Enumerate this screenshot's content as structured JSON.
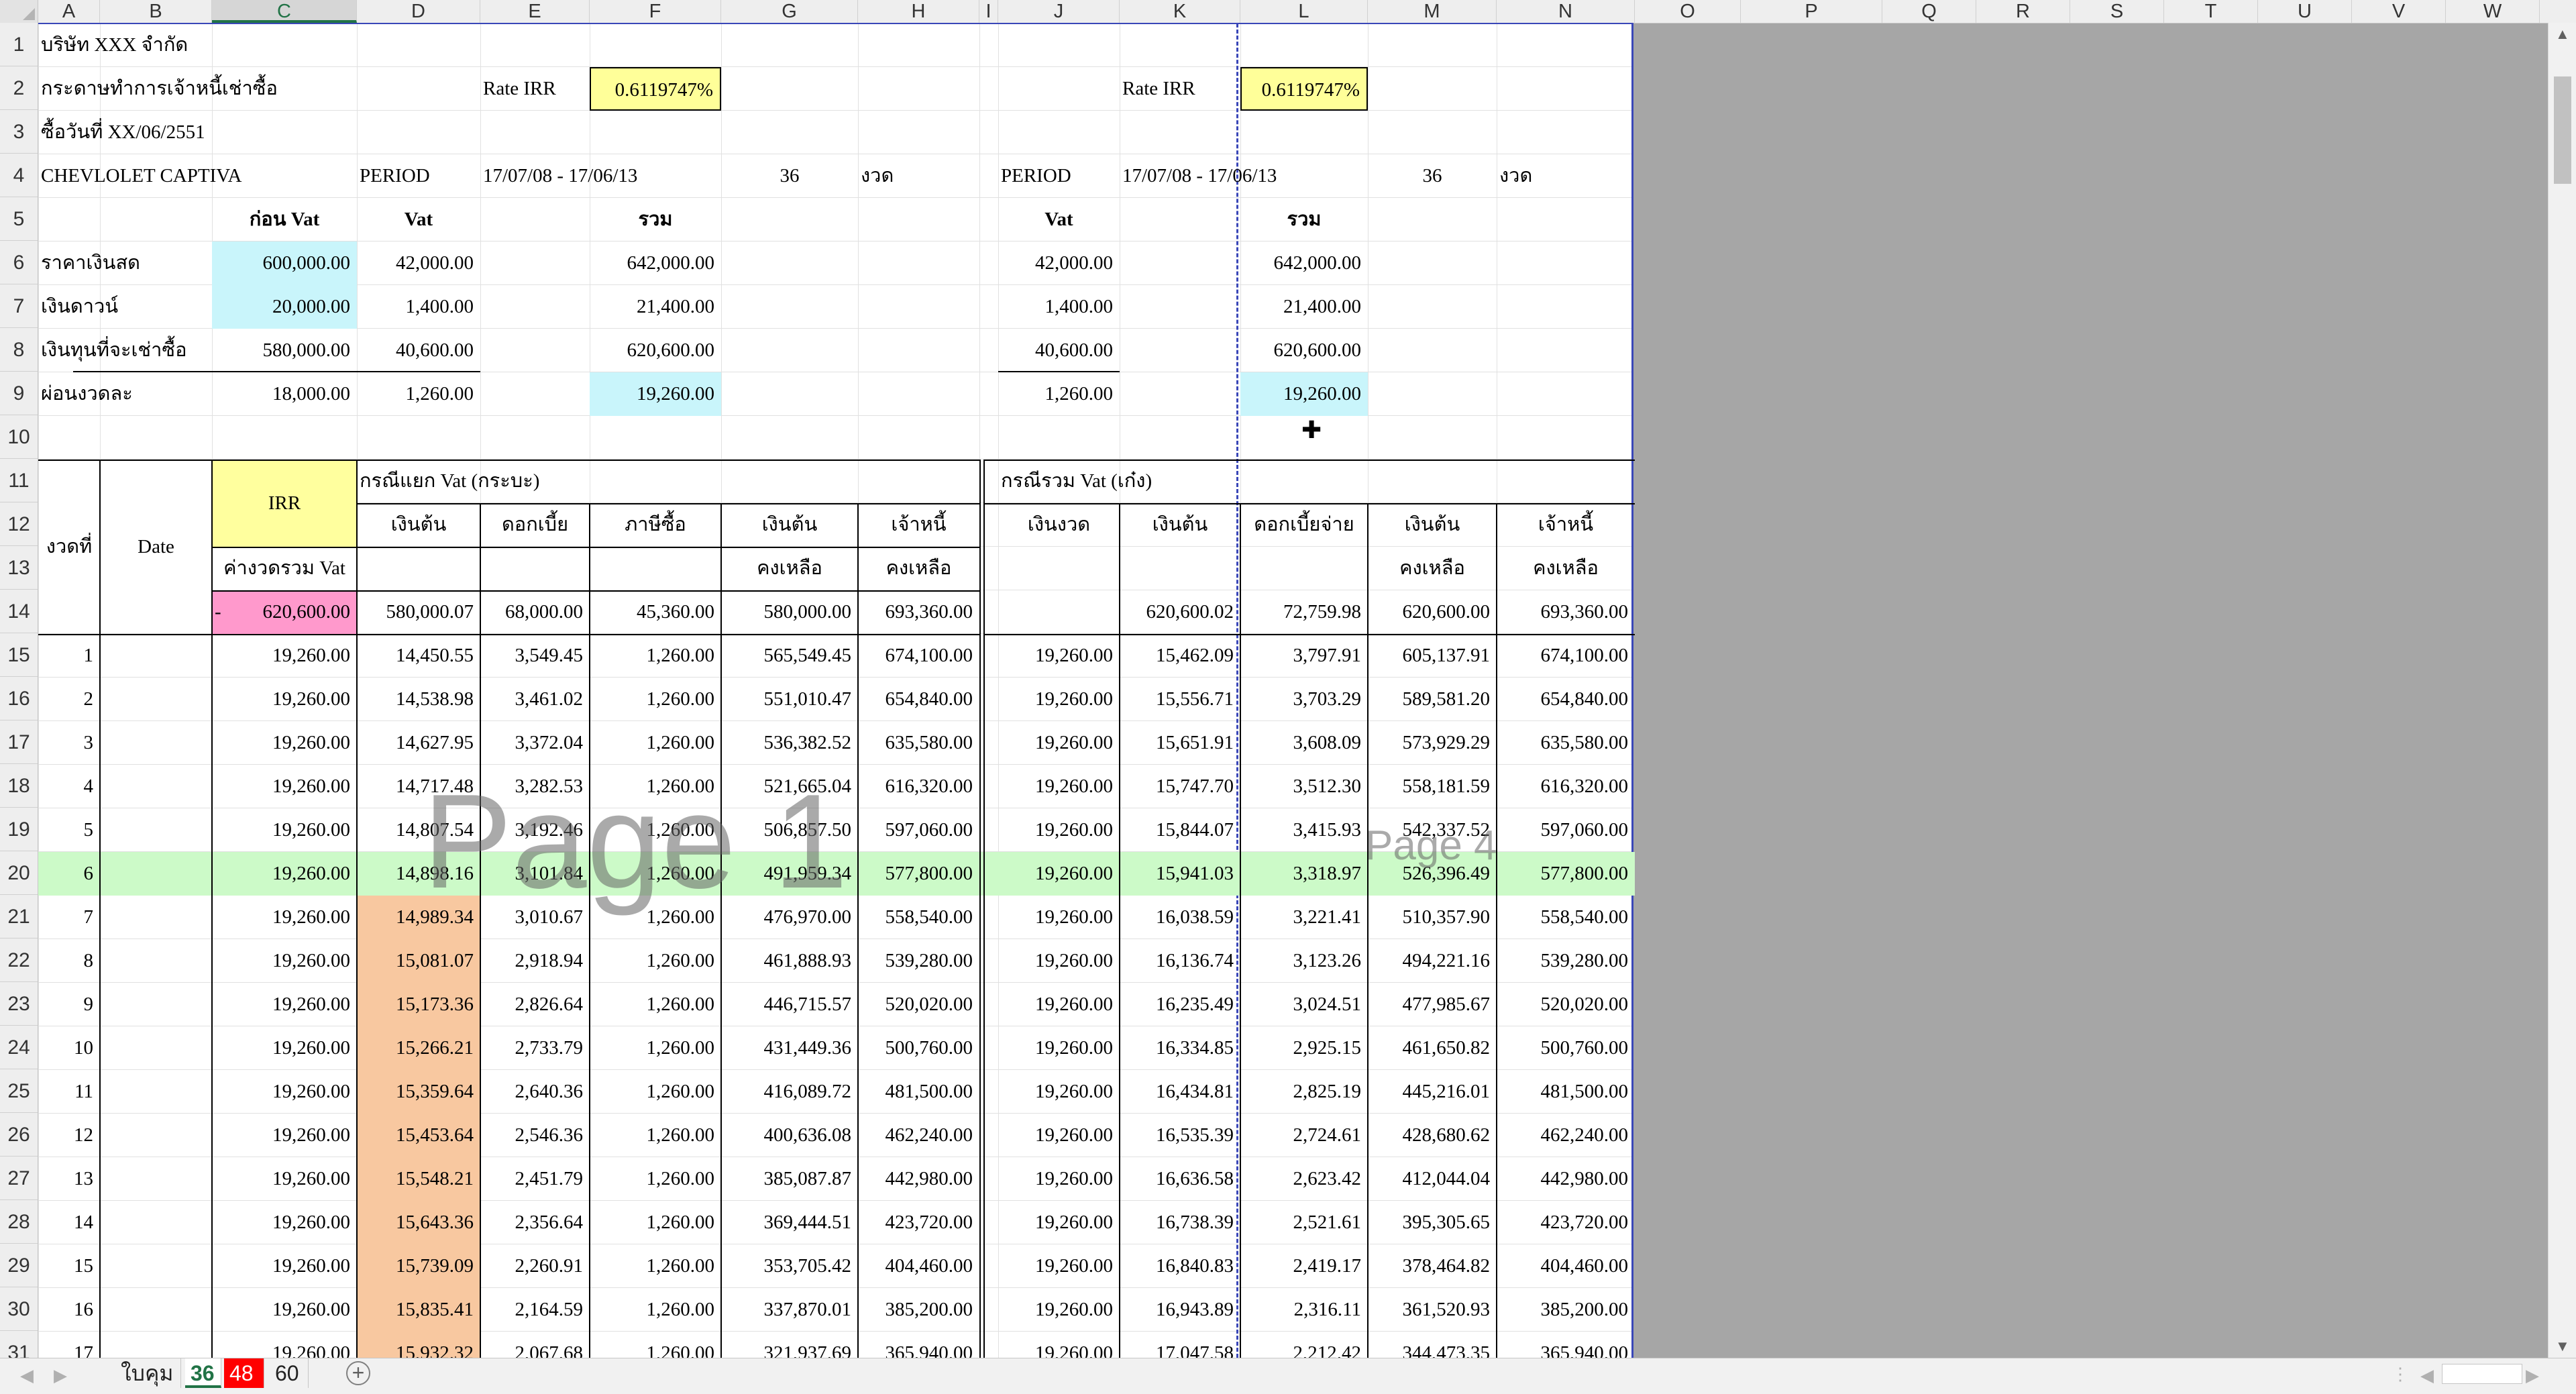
{
  "app": {
    "name": "Spreadsheet"
  },
  "columns": [
    "A",
    "B",
    "C",
    "D",
    "E",
    "F",
    "G",
    "H",
    "I",
    "J",
    "K",
    "L",
    "M",
    "N",
    "O",
    "P",
    "Q",
    "R",
    "S",
    "T",
    "U",
    "V",
    "W"
  ],
  "active_column": "C",
  "rows": [
    "1",
    "2",
    "3",
    "4",
    "5",
    "6",
    "7",
    "8",
    "9",
    "10",
    "11",
    "12",
    "13",
    "14",
    "15",
    "16",
    "17",
    "18",
    "19",
    "20",
    "21",
    "22",
    "23",
    "24",
    "25",
    "26",
    "27",
    "28",
    "29",
    "30",
    "31"
  ],
  "header": {
    "company": "บริษัท XXX จำกัด",
    "desc": "กระดาษทำการเจ้าหนี้เช่าซื้อ",
    "purchase_date": "ซื้อวันที่ XX/06/2551",
    "car": "CHEVLOLET CAPTIVA",
    "rate_label": "Rate IRR",
    "rate_value": "0.6119747%",
    "period_label": "PERIOD",
    "period_value": "17/07/08 - 17/06/13",
    "period_count": "36",
    "period_unit": "งวด",
    "col_before_vat": "ก่อน Vat",
    "col_vat": "Vat",
    "col_total": "รวม"
  },
  "summary": [
    {
      "label": "ราคาเงินสด",
      "before": "600,000.00",
      "vat": "42,000.00",
      "total": "642,000.00",
      "r_vat": "42,000.00",
      "r_total": "642,000.00"
    },
    {
      "label": "เงินดาวน์",
      "before": "20,000.00",
      "vat": "1,400.00",
      "total": "21,400.00",
      "r_vat": "1,400.00",
      "r_total": "21,400.00"
    },
    {
      "label": "เงินทุนที่จะเช่าซื้อ",
      "before": "580,000.00",
      "vat": "40,600.00",
      "total": "620,600.00",
      "r_vat": "40,600.00",
      "r_total": "620,600.00"
    },
    {
      "label": "ผ่อนงวดละ",
      "before": "18,000.00",
      "vat": "1,260.00",
      "total": "19,260.00",
      "r_vat": "1,260.00",
      "r_total": "19,260.00"
    }
  ],
  "table_header": {
    "no": "งวดที่",
    "date": "Date",
    "irr": "IRR",
    "irr_sub": "ค่างวดรวม Vat",
    "left_title": "กรณีแยก Vat (กระบะ)",
    "left_cols": [
      "เงินต้น",
      "ดอกเบี้ย",
      "ภาษีซื้อ",
      "เงินต้น",
      "เจ้าหนี้"
    ],
    "left_sub": [
      "",
      "",
      "",
      "คงเหลือ",
      "คงเหลือ"
    ],
    "right_title": "กรณีรวม Vat (เก๋ง)",
    "right_cols": [
      "เงินงวด",
      "เงินต้น",
      "ดอกเบี้ยจ่าย",
      "เงินต้น",
      "เจ้าหนี้"
    ],
    "right_sub": [
      "",
      "",
      "",
      "คงเหลือ",
      "คงเหลือ"
    ]
  },
  "row14": {
    "dash": "-",
    "c": "620,600.00",
    "d": "580,000.07",
    "e": "68,000.00",
    "f": "45,360.00",
    "g": "580,000.00",
    "h": "693,360.00",
    "k": "620,600.02",
    "l": "72,759.98",
    "m": "620,600.00",
    "n": "693,360.00"
  },
  "schedule": [
    {
      "n": "1",
      "c": "19,260.00",
      "d": "14,450.55",
      "e": "3,549.45",
      "f": "1,260.00",
      "g": "565,549.45",
      "h": "674,100.00",
      "j": "19,260.00",
      "k": "15,462.09",
      "l": "3,797.91",
      "m": "605,137.91",
      "nn": "674,100.00"
    },
    {
      "n": "2",
      "c": "19,260.00",
      "d": "14,538.98",
      "e": "3,461.02",
      "f": "1,260.00",
      "g": "551,010.47",
      "h": "654,840.00",
      "j": "19,260.00",
      "k": "15,556.71",
      "l": "3,703.29",
      "m": "589,581.20",
      "nn": "654,840.00"
    },
    {
      "n": "3",
      "c": "19,260.00",
      "d": "14,627.95",
      "e": "3,372.04",
      "f": "1,260.00",
      "g": "536,382.52",
      "h": "635,580.00",
      "j": "19,260.00",
      "k": "15,651.91",
      "l": "3,608.09",
      "m": "573,929.29",
      "nn": "635,580.00"
    },
    {
      "n": "4",
      "c": "19,260.00",
      "d": "14,717.48",
      "e": "3,282.53",
      "f": "1,260.00",
      "g": "521,665.04",
      "h": "616,320.00",
      "j": "19,260.00",
      "k": "15,747.70",
      "l": "3,512.30",
      "m": "558,181.59",
      "nn": "616,320.00"
    },
    {
      "n": "5",
      "c": "19,260.00",
      "d": "14,807.54",
      "e": "3,192.46",
      "f": "1,260.00",
      "g": "506,857.50",
      "h": "597,060.00",
      "j": "19,260.00",
      "k": "15,844.07",
      "l": "3,415.93",
      "m": "542,337.52",
      "nn": "597,060.00"
    },
    {
      "n": "6",
      "c": "19,260.00",
      "d": "14,898.16",
      "e": "3,101.84",
      "f": "1,260.00",
      "g": "491,959.34",
      "h": "577,800.00",
      "j": "19,260.00",
      "k": "15,941.03",
      "l": "3,318.97",
      "m": "526,396.49",
      "nn": "577,800.00"
    },
    {
      "n": "7",
      "c": "19,260.00",
      "d": "14,989.34",
      "e": "3,010.67",
      "f": "1,260.00",
      "g": "476,970.00",
      "h": "558,540.00",
      "j": "19,260.00",
      "k": "16,038.59",
      "l": "3,221.41",
      "m": "510,357.90",
      "nn": "558,540.00"
    },
    {
      "n": "8",
      "c": "19,260.00",
      "d": "15,081.07",
      "e": "2,918.94",
      "f": "1,260.00",
      "g": "461,888.93",
      "h": "539,280.00",
      "j": "19,260.00",
      "k": "16,136.74",
      "l": "3,123.26",
      "m": "494,221.16",
      "nn": "539,280.00"
    },
    {
      "n": "9",
      "c": "19,260.00",
      "d": "15,173.36",
      "e": "2,826.64",
      "f": "1,260.00",
      "g": "446,715.57",
      "h": "520,020.00",
      "j": "19,260.00",
      "k": "16,235.49",
      "l": "3,024.51",
      "m": "477,985.67",
      "nn": "520,020.00"
    },
    {
      "n": "10",
      "c": "19,260.00",
      "d": "15,266.21",
      "e": "2,733.79",
      "f": "1,260.00",
      "g": "431,449.36",
      "h": "500,760.00",
      "j": "19,260.00",
      "k": "16,334.85",
      "l": "2,925.15",
      "m": "461,650.82",
      "nn": "500,760.00"
    },
    {
      "n": "11",
      "c": "19,260.00",
      "d": "15,359.64",
      "e": "2,640.36",
      "f": "1,260.00",
      "g": "416,089.72",
      "h": "481,500.00",
      "j": "19,260.00",
      "k": "16,434.81",
      "l": "2,825.19",
      "m": "445,216.01",
      "nn": "481,500.00"
    },
    {
      "n": "12",
      "c": "19,260.00",
      "d": "15,453.64",
      "e": "2,546.36",
      "f": "1,260.00",
      "g": "400,636.08",
      "h": "462,240.00",
      "j": "19,260.00",
      "k": "16,535.39",
      "l": "2,724.61",
      "m": "428,680.62",
      "nn": "462,240.00"
    },
    {
      "n": "13",
      "c": "19,260.00",
      "d": "15,548.21",
      "e": "2,451.79",
      "f": "1,260.00",
      "g": "385,087.87",
      "h": "442,980.00",
      "j": "19,260.00",
      "k": "16,636.58",
      "l": "2,623.42",
      "m": "412,044.04",
      "nn": "442,980.00"
    },
    {
      "n": "14",
      "c": "19,260.00",
      "d": "15,643.36",
      "e": "2,356.64",
      "f": "1,260.00",
      "g": "369,444.51",
      "h": "423,720.00",
      "j": "19,260.00",
      "k": "16,738.39",
      "l": "2,521.61",
      "m": "395,305.65",
      "nn": "423,720.00"
    },
    {
      "n": "15",
      "c": "19,260.00",
      "d": "15,739.09",
      "e": "2,260.91",
      "f": "1,260.00",
      "g": "353,705.42",
      "h": "404,460.00",
      "j": "19,260.00",
      "k": "16,840.83",
      "l": "2,419.17",
      "m": "378,464.82",
      "nn": "404,460.00"
    },
    {
      "n": "16",
      "c": "19,260.00",
      "d": "15,835.41",
      "e": "2,164.59",
      "f": "1,260.00",
      "g": "337,870.01",
      "h": "385,200.00",
      "j": "19,260.00",
      "k": "16,943.89",
      "l": "2,316.11",
      "m": "361,520.93",
      "nn": "385,200.00"
    },
    {
      "n": "17",
      "c": "19,260.00",
      "d": "15,932.32",
      "e": "2,067.68",
      "f": "1,260.00",
      "g": "321,937.69",
      "h": "365,940.00",
      "j": "19,260.00",
      "k": "17,047.58",
      "l": "2,212.42",
      "m": "344,473.35",
      "nn": "365,940.00"
    }
  ],
  "watermarks": {
    "page1": "Page 1",
    "page4": "Page 4"
  },
  "sheet_tabs": [
    "ใบคุม",
    "36",
    "48",
    "60"
  ],
  "active_tab": "36",
  "colors": {
    "yellow": "#ffff99",
    "cyan": "#c9f5fb",
    "pink": "#ff99cc",
    "green": "#ccfac8",
    "orange": "#f8c8a0",
    "page_break": "#3a47b8",
    "tab_red": "#ff0000"
  }
}
